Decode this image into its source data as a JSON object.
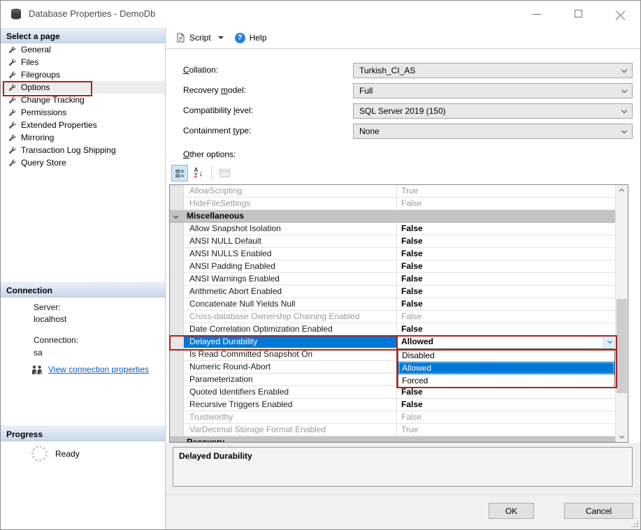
{
  "window": {
    "title": "Database Properties - DemoDb"
  },
  "sidebar": {
    "select_page_header": "Select a page",
    "items": [
      {
        "label": "General",
        "selected": false
      },
      {
        "label": "Files",
        "selected": false
      },
      {
        "label": "Filegroups",
        "selected": false
      },
      {
        "label": "Options",
        "selected": true,
        "annotated": true
      },
      {
        "label": "Change Tracking",
        "selected": false
      },
      {
        "label": "Permissions",
        "selected": false
      },
      {
        "label": "Extended Properties",
        "selected": false
      },
      {
        "label": "Mirroring",
        "selected": false
      },
      {
        "label": "Transaction Log Shipping",
        "selected": false
      },
      {
        "label": "Query Store",
        "selected": false
      }
    ],
    "connection_header": "Connection",
    "server_label": "Server:",
    "server_value": "localhost",
    "connection_label": "Connection:",
    "connection_value": "sa",
    "view_connection_link": "View connection properties",
    "progress_header": "Progress",
    "progress_status": "Ready"
  },
  "toolbar": {
    "script_label": "Script",
    "help_label": "Help"
  },
  "form": {
    "collation": {
      "pre": "",
      "key": "C",
      "post": "ollation:",
      "value": "Turkish_CI_AS"
    },
    "recovery_model": {
      "pre": "Recovery ",
      "key": "m",
      "post": "odel:",
      "value": "Full"
    },
    "compatibility_level": {
      "pre": "Compatibility ",
      "key": "l",
      "post": "evel:",
      "value": "SQL Server 2019 (150)"
    },
    "containment_type": {
      "pre": "Containment ",
      "key": "t",
      "post": "ype:",
      "value": "None"
    },
    "other_options_label": {
      "pre": "",
      "key": "O",
      "post": "ther options:"
    }
  },
  "grid": {
    "rows": [
      {
        "name": "AllowScripting",
        "value": "True",
        "state": "disabled"
      },
      {
        "name": "HideFileSettings",
        "value": "False",
        "state": "disabled"
      },
      {
        "name": "Miscellaneous",
        "value": "",
        "state": "category"
      },
      {
        "name": "Allow Snapshot Isolation",
        "value": "False",
        "state": "normal"
      },
      {
        "name": "ANSI NULL Default",
        "value": "False",
        "state": "normal"
      },
      {
        "name": "ANSI NULLS Enabled",
        "value": "False",
        "state": "normal"
      },
      {
        "name": "ANSI Padding Enabled",
        "value": "False",
        "state": "normal"
      },
      {
        "name": "ANSI Warnings Enabled",
        "value": "False",
        "state": "normal"
      },
      {
        "name": "Arithmetic Abort Enabled",
        "value": "False",
        "state": "normal"
      },
      {
        "name": "Concatenate Null Yields Null",
        "value": "False",
        "state": "normal"
      },
      {
        "name": "Cross-database Ownership Chaining Enabled",
        "value": "False",
        "state": "disabled"
      },
      {
        "name": "Date Correlation Optimization Enabled",
        "value": "False",
        "state": "normal"
      },
      {
        "name": "Delayed Durability",
        "value": "Allowed",
        "state": "selected"
      },
      {
        "name": "Is Read Committed Snapshot On",
        "value": "",
        "state": "normal"
      },
      {
        "name": "Numeric Round-Abort",
        "value": "",
        "state": "normal"
      },
      {
        "name": "Parameterization",
        "value": "",
        "state": "normal"
      },
      {
        "name": "Quoted Identifiers Enabled",
        "value": "False",
        "state": "normal"
      },
      {
        "name": "Recursive Triggers Enabled",
        "value": "False",
        "state": "normal"
      },
      {
        "name": "Trustworthy",
        "value": "False",
        "state": "disabled"
      },
      {
        "name": "VarDecimal Storage Format Enabled",
        "value": "True",
        "state": "disabled"
      },
      {
        "name": "Recovery",
        "value": "",
        "state": "category"
      }
    ],
    "dropdown": {
      "items": [
        "Disabled",
        "Allowed",
        "Forced"
      ],
      "selected_index": 1
    }
  },
  "description_panel": {
    "title": "Delayed Durability"
  },
  "footer": {
    "ok_label": "OK",
    "cancel_label": "Cancel"
  },
  "icons": {
    "help": "?",
    "sort_a": "A",
    "sort_z": "Z",
    "sort_arrow": "↓"
  },
  "colors": {
    "accent": "#0078d7",
    "annotation": "#b02020",
    "link": "#0a5bc4"
  }
}
